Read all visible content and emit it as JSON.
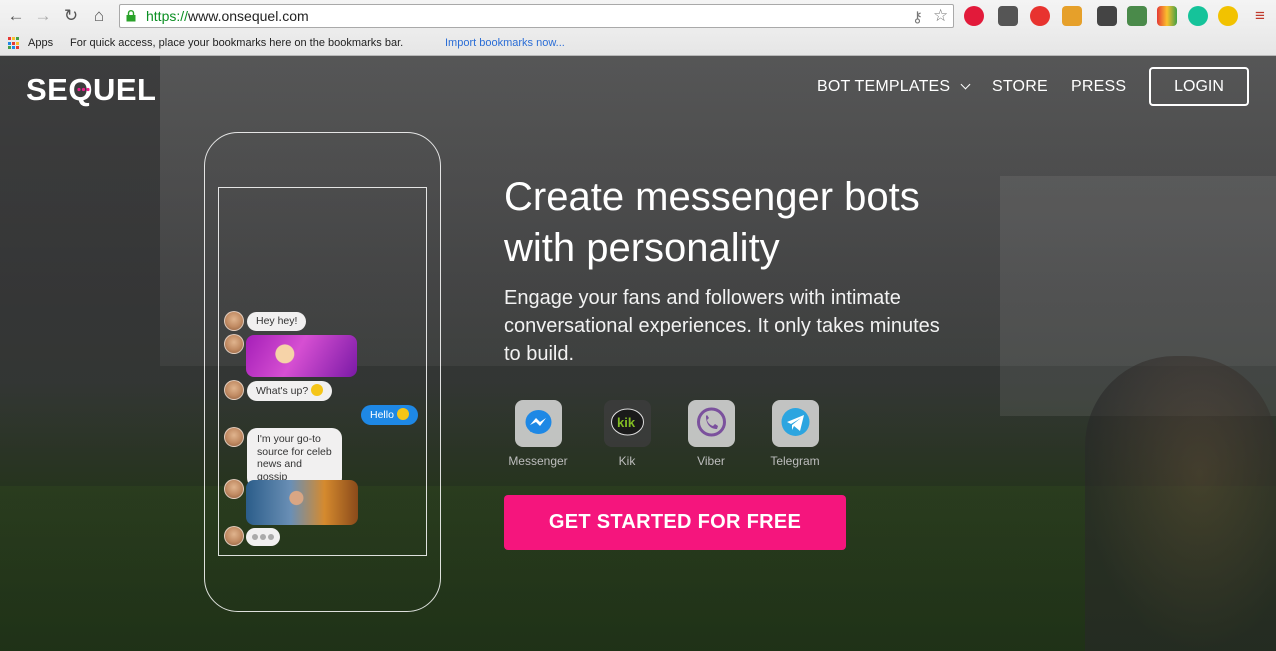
{
  "browser": {
    "url_scheme": "https://",
    "url_rest": "www.onsequel.com",
    "bookmarks_apps": "Apps",
    "bookmarks_hint": "For quick access, place your bookmarks here on the bookmarks bar.",
    "bookmarks_import": "Import bookmarks now..."
  },
  "nav": {
    "logo": "SEQUEL",
    "items": [
      {
        "label": "BOT TEMPLATES",
        "has_dropdown": true
      },
      {
        "label": "STORE"
      },
      {
        "label": "PRESS"
      }
    ],
    "login": "LOGIN"
  },
  "chat": {
    "messages": [
      {
        "from": "bot",
        "text": "Hey hey!"
      },
      {
        "from": "bot",
        "type": "gif"
      },
      {
        "from": "bot",
        "text": "What's up?"
      },
      {
        "from": "user",
        "text": "Hello"
      },
      {
        "from": "bot",
        "text": "I'm your go-to source  for celeb news and gossip"
      },
      {
        "from": "bot",
        "type": "gif"
      },
      {
        "from": "bot",
        "type": "typing"
      }
    ]
  },
  "hero": {
    "title": "Create messenger bots with personality",
    "subtitle": "Engage your fans and followers with intimate conversational experiences. It only takes minutes to build.",
    "platforms": [
      {
        "label": "Messenger",
        "icon": "messenger-icon",
        "color": "#1e88e5"
      },
      {
        "label": "Kik",
        "icon": "kik-icon",
        "color": "#82bc23"
      },
      {
        "label": "Viber",
        "icon": "viber-icon",
        "color": "#7b519d"
      },
      {
        "label": "Telegram",
        "icon": "telegram-icon",
        "color": "#2ca5e0"
      }
    ],
    "cta": "GET STARTED FOR FREE"
  },
  "colors": {
    "cta": "#f5157d",
    "user_bubble": "#1e88e5",
    "logo_dots": "#e91e8c"
  }
}
